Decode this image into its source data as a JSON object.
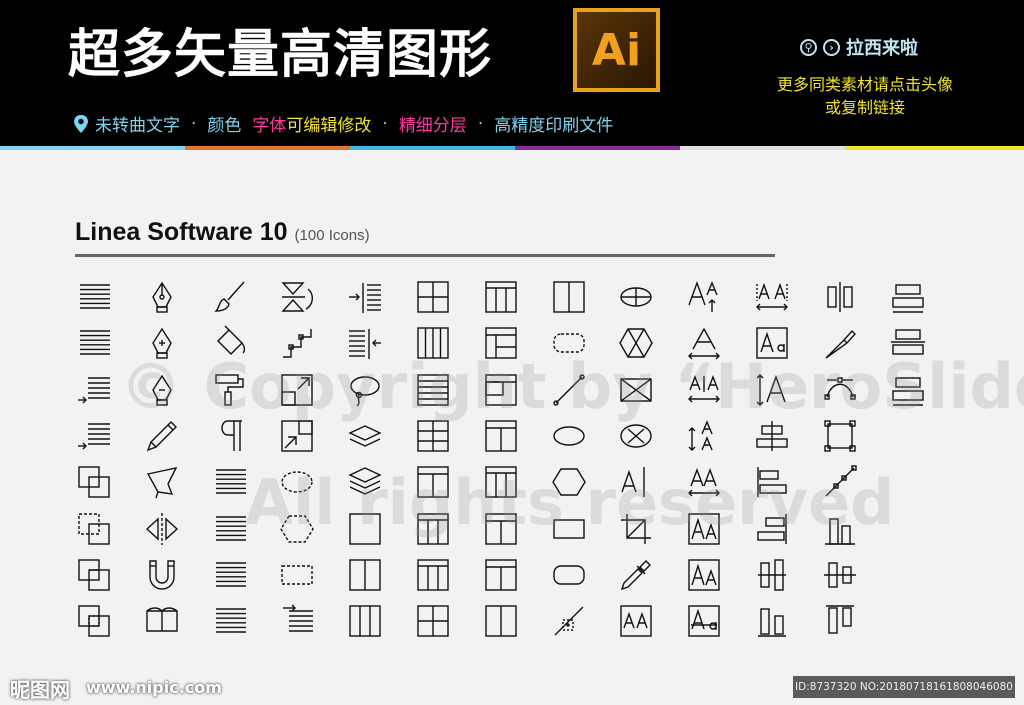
{
  "banner": {
    "title": "超多矢量高清图形",
    "logo_text": "Ai",
    "brand_label": "拉西来啦",
    "promo_line1": "更多同类素材请点击头像",
    "promo_line2": "或复制链接",
    "features": [
      {
        "text": "未转曲文字",
        "color": "#7fd4f0"
      },
      {
        "text": "颜色",
        "color": "#7fd4f0"
      },
      {
        "text": "字体",
        "color": "#ff3aa4"
      },
      {
        "text": "可编辑修改",
        "color": "#f0e32a"
      },
      {
        "text": "精细分层",
        "color": "#ff3aa4"
      },
      {
        "text": "高精度印刷文件",
        "color": "#7fd4f0"
      }
    ],
    "separator": "·",
    "stripe_colors": [
      "#7fd4f0",
      "#e2772b",
      "#3fb7e6",
      "#8a2b9b",
      "#e0e0e0",
      "#f0e32a"
    ]
  },
  "panel": {
    "title": "Linea Software 10",
    "count": "(100 Icons)"
  },
  "watermark": {
    "line1": "© Copyright by “HeroSlide”",
    "line2": "All rights reserved"
  },
  "footer": {
    "site_logo": "昵图网",
    "site_url": "www.nipic.com",
    "image_id": "ID:8737320 NO:20180718161808046080"
  },
  "icons": {
    "grid": [
      [
        "lines",
        "pen-nib",
        "brush",
        "flip",
        "indent-left",
        "grid-4",
        "table-cols",
        "split-2",
        "ellipse-line",
        "font-size-up",
        "kerning",
        "align-bracket",
        "stack-wide"
      ],
      [
        "lines",
        "pen-add",
        "paint-bucket",
        "path-steps",
        "indent-right",
        "cols-4",
        "layout-side",
        "dashed-round",
        "hexagon-cross",
        "font-width",
        "font-box",
        "knife",
        "stack-center"
      ],
      [
        "lines-arrow",
        "pen-remove",
        "roller",
        "resize-out",
        "lasso",
        "rows-5",
        "layout-inner",
        "line-diag",
        "envelope-x",
        "kern-small",
        "font-tall",
        "bezier",
        "stack-wide"
      ],
      [
        "lines-arrow",
        "pencil",
        "pilcrow",
        "resize-in",
        "layers",
        "table-3",
        "layout-split",
        "ellipse",
        "circle-x",
        "font-height",
        "align-center-v",
        "select-points",
        ""
      ],
      [
        "copy",
        "flag",
        "lines",
        "dashed-ellipse",
        "layers-stack",
        "layout-header",
        "table-cols",
        "hexagon",
        "text-cursor",
        "font-kern",
        "align-left-bars",
        "path-diag",
        ""
      ],
      [
        "copy-dashed",
        "mirror",
        "lines",
        "dashed-hexagon",
        "square",
        "table-cols",
        "layout-header",
        "rect",
        "crop",
        "font-box-a",
        "align-right-bars",
        "bar-chart",
        ""
      ],
      [
        "copy-offset",
        "magnet",
        "lines",
        "dashed-rect",
        "split-2",
        "table-cols",
        "layout-header",
        "rounded-rect",
        "dropper",
        "font-box-a",
        "align-v-bars",
        "align-h-center",
        ""
      ],
      [
        "copy-inner",
        "book",
        "lines",
        "indent-lines",
        "split-3",
        "grid-4",
        "split-2",
        "path-add",
        "font-box-aa",
        "font-box-strike",
        "align-bottom",
        "align-top",
        ""
      ]
    ]
  }
}
